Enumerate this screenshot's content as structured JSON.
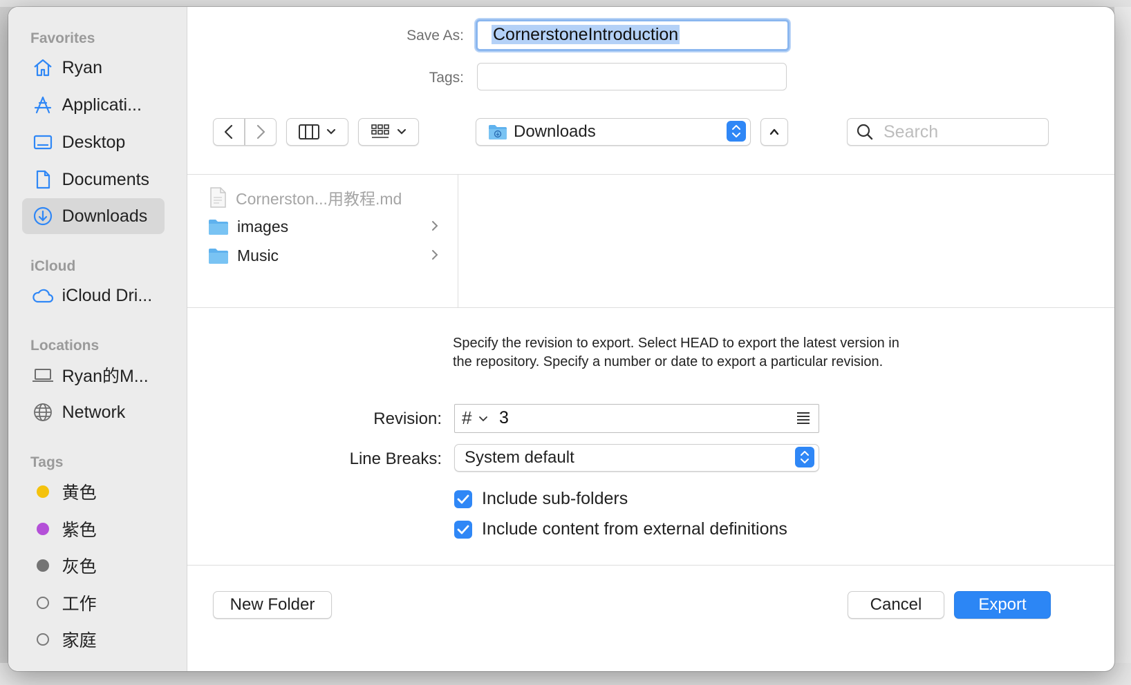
{
  "dialog": {
    "save_as_label": "Save As:",
    "save_as_value": "CornerstoneIntroduction",
    "tags_label": "Tags:",
    "tags_value": ""
  },
  "sidebar": {
    "favorites_header": "Favorites",
    "favorites": [
      {
        "label": "Ryan",
        "icon": "home-icon"
      },
      {
        "label": "Applicati...",
        "icon": "applications-icon"
      },
      {
        "label": "Desktop",
        "icon": "desktop-icon"
      },
      {
        "label": "Documents",
        "icon": "document-icon"
      },
      {
        "label": "Downloads",
        "icon": "downloads-icon",
        "selected": true
      }
    ],
    "icloud_header": "iCloud",
    "icloud": [
      {
        "label": "iCloud Dri...",
        "icon": "cloud-icon"
      }
    ],
    "locations_header": "Locations",
    "locations": [
      {
        "label": "Ryan的M...",
        "icon": "laptop-icon"
      },
      {
        "label": "Network",
        "icon": "globe-icon"
      }
    ],
    "tags_header": "Tags",
    "tags": [
      {
        "label": "黄色",
        "color": "#f4c20d"
      },
      {
        "label": "紫色",
        "color": "#b450d8"
      },
      {
        "label": "灰色",
        "color": "#747474"
      },
      {
        "label": "工作",
        "color": "hollow"
      },
      {
        "label": "家庭",
        "color": "hollow"
      }
    ]
  },
  "toolbar": {
    "location": "Downloads",
    "search_placeholder": "Search"
  },
  "browser": {
    "files": [
      {
        "name": "Cornerston...用教程.md",
        "type": "file",
        "dim": true
      },
      {
        "name": "images",
        "type": "folder"
      },
      {
        "name": "Music",
        "type": "folder"
      }
    ]
  },
  "options": {
    "description": "Specify the revision to export. Select HEAD to export the latest version in the repository. Specify a number or date to export a particular revision.",
    "revision_label": "Revision:",
    "revision_prefix": "#",
    "revision_value": "3",
    "line_breaks_label": "Line Breaks:",
    "line_breaks_value": "System default",
    "include_subfolders": "Include sub-folders",
    "include_external": "Include content from external definitions"
  },
  "footer": {
    "new_folder": "New Folder",
    "cancel": "Cancel",
    "export": "Export"
  },
  "colors": {
    "accent": "#2c86f5",
    "sidebar_icon": "#2f87f6"
  }
}
